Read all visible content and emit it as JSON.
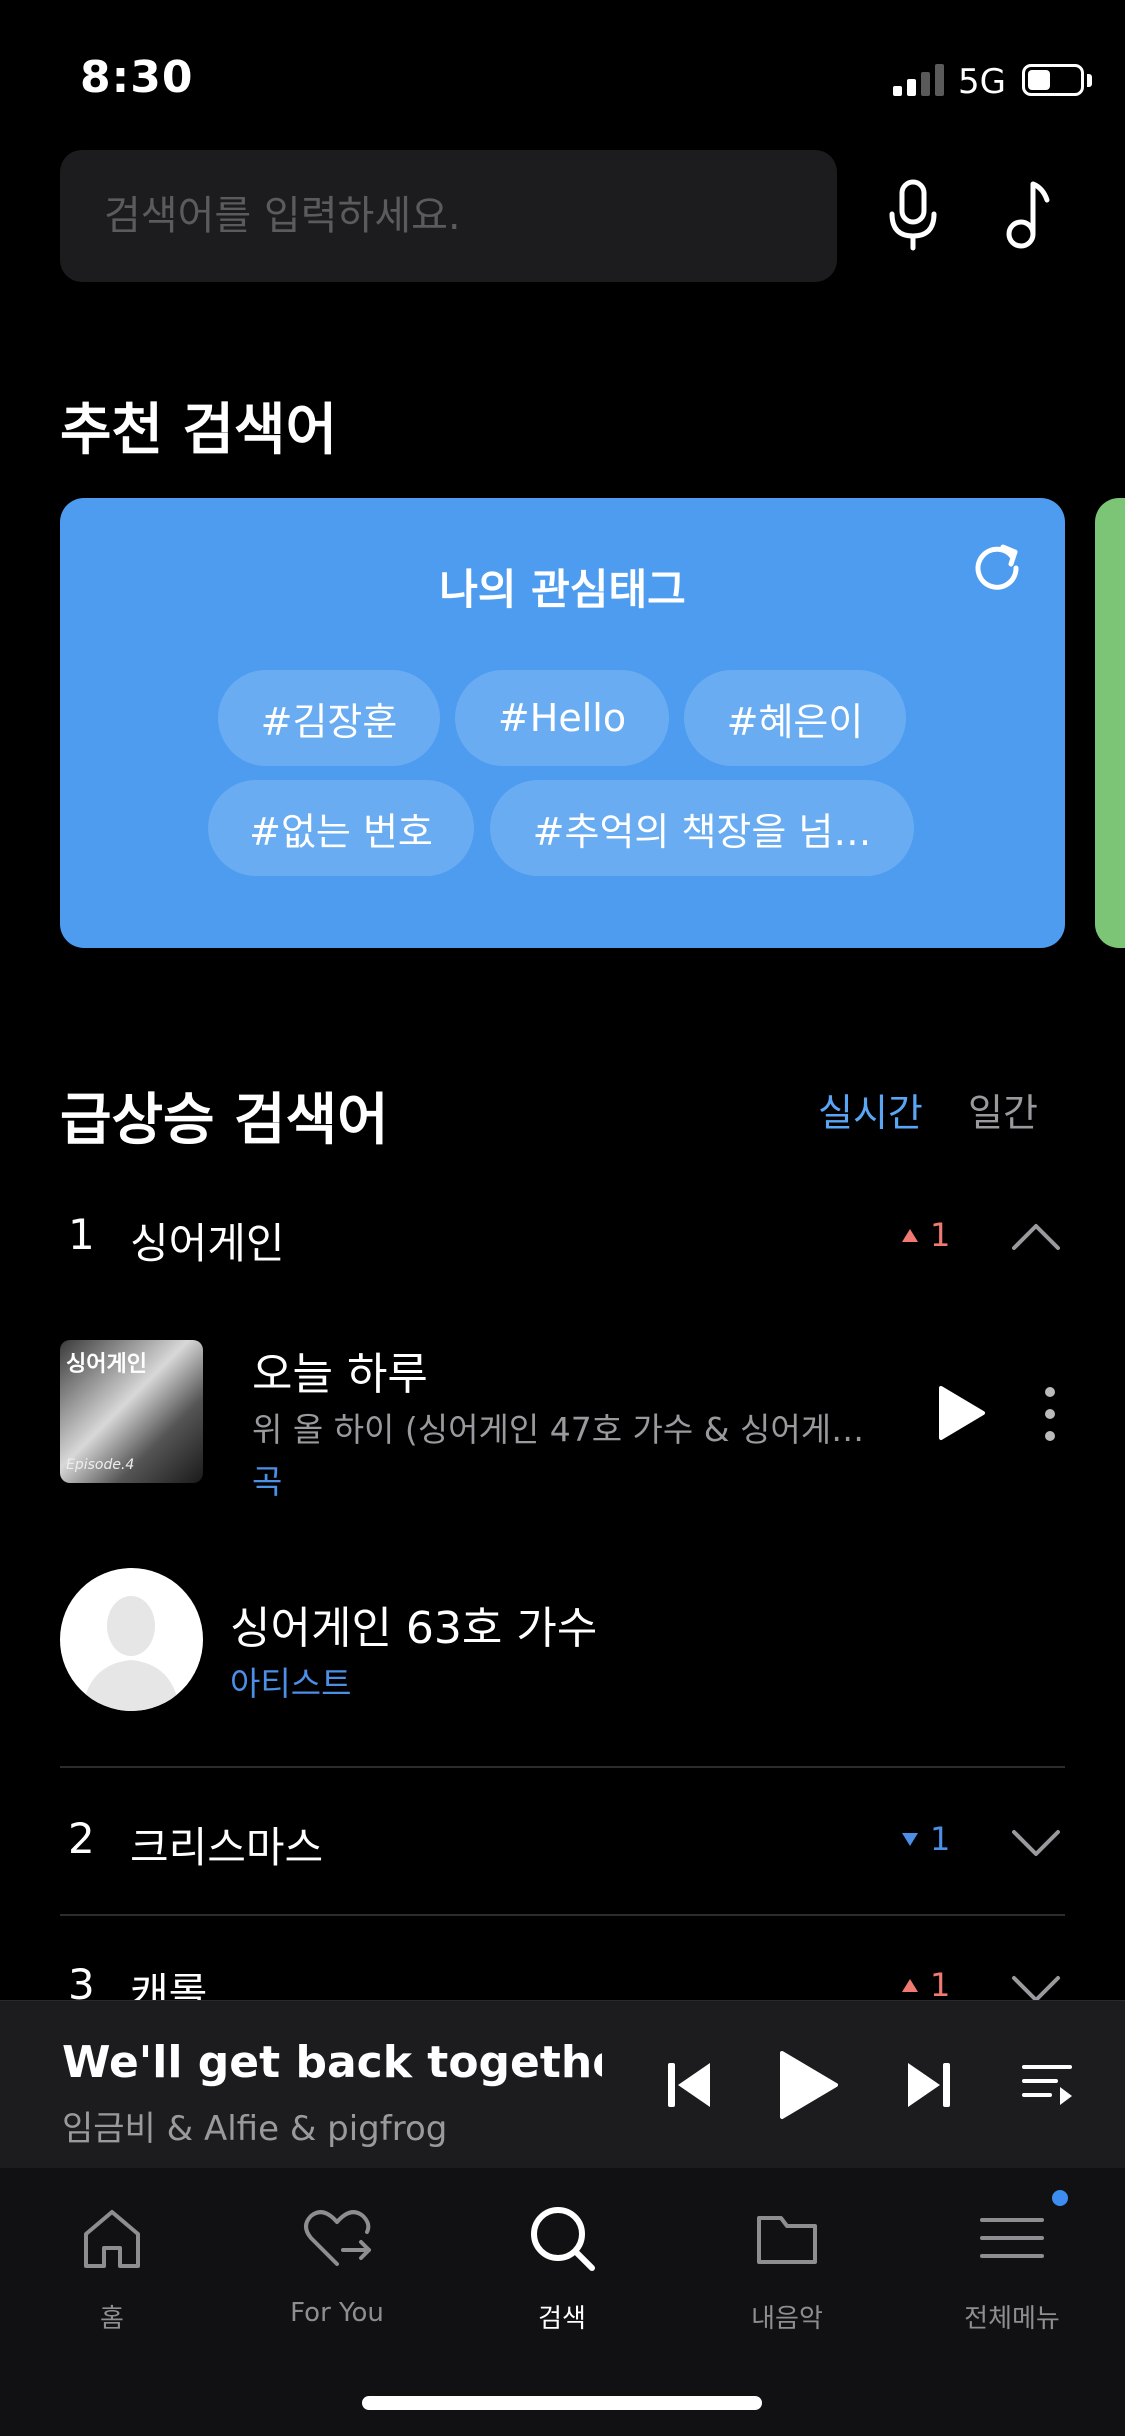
{
  "status_bar": {
    "time": "8:30",
    "network": "5G"
  },
  "search": {
    "placeholder": "검색어를 입력하세요.",
    "value": ""
  },
  "recommend": {
    "title": "추천 검색어",
    "card_title": "나의 관심태그",
    "tags": [
      "#김장훈",
      "#Hello",
      "#혜은이",
      "#없는 번호",
      "#추억의 책장을 넘…"
    ],
    "card_color": "#4d9cf0",
    "next_card_color": "#7cc576"
  },
  "rising": {
    "title": "급상승 검색어",
    "tabs": {
      "realtime": "실시간",
      "daily": "일간"
    },
    "items": [
      {
        "rank": "1",
        "keyword": "싱어게인",
        "change": "1",
        "direction": "up"
      },
      {
        "rank": "2",
        "keyword": "크리스마스",
        "change": "1",
        "direction": "down"
      },
      {
        "rank": "3",
        "keyword": "캐롤",
        "change": "1",
        "direction": "up"
      }
    ],
    "expanded": {
      "song": {
        "title": "오늘 하루",
        "artist": "위 올 하이 (싱어게인 47호 가수 & 싱어게…",
        "type": "곡",
        "art_title": "싱어게인",
        "art_subtitle": "Episode.4"
      },
      "artist": {
        "name": "싱어게인 63호 가수",
        "type": "아티스트"
      }
    }
  },
  "player": {
    "title": "We'll get back together...",
    "artist": "임금비 & Alfie & pigfrog"
  },
  "nav": [
    {
      "label": "홈",
      "icon": "home-icon"
    },
    {
      "label": "For You",
      "icon": "heart-arrow-icon"
    },
    {
      "label": "검색",
      "icon": "search-icon"
    },
    {
      "label": "내음악",
      "icon": "folder-icon"
    },
    {
      "label": "전체메뉴",
      "icon": "menu-icon"
    }
  ],
  "colors": {
    "accent": "#4b8fe6",
    "up": "#f07a72",
    "down": "#4b8fe6"
  }
}
